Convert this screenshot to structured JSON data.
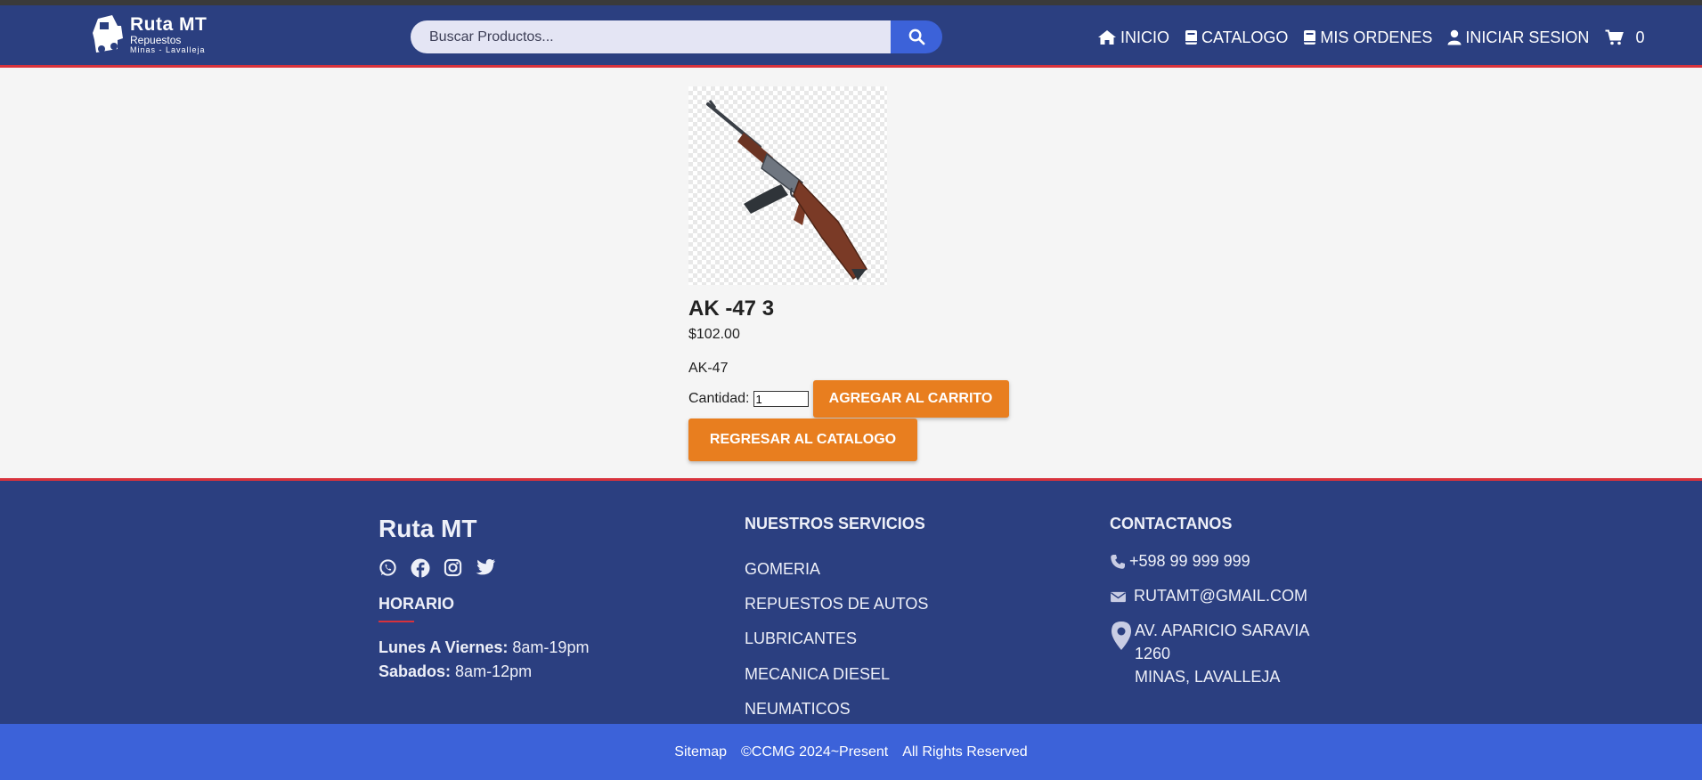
{
  "header": {
    "brand_name": "Ruta MT",
    "brand_sub": "Repuestos",
    "brand_location": "Minas - Lavalleja",
    "search_placeholder": "Buscar Productos...",
    "nav": [
      {
        "label": "INICIO",
        "icon": "home-icon"
      },
      {
        "label": "CATALOGO",
        "icon": "book-icon"
      },
      {
        "label": "MIS ORDENES",
        "icon": "book-icon"
      },
      {
        "label": "INICIAR SESION",
        "icon": "user-icon"
      }
    ],
    "cart_count": "0"
  },
  "product": {
    "title": "AK -47 3",
    "price": "$102.00",
    "description": "AK-47",
    "quantity_label": "Cantidad:",
    "quantity_value": "1",
    "add_to_cart_label": "AGREGAR AL CARRITO",
    "back_label": "REGRESAR AL CATALOGO"
  },
  "footer": {
    "brand": "Ruta MT",
    "social": [
      "whatsapp-icon",
      "facebook-icon",
      "instagram-icon",
      "twitter-icon"
    ],
    "hours_title": "HORARIO",
    "hours": [
      {
        "day": "Lunes A Viernes:",
        "time": "8am-19pm"
      },
      {
        "day": "Sabados:",
        "time": "8am-12pm"
      }
    ],
    "services_title": "NUESTROS SERVICIOS",
    "services": [
      "GOMERIA",
      "REPUESTOS DE AUTOS",
      "LUBRICANTES",
      "MECANICA DIESEL",
      "NEUMATICOS"
    ],
    "contact_title": "CONTACTANOS",
    "phone": "+598 99 999 999",
    "email": "RUTAMT@GMAIL.COM",
    "address_line1": "AV. APARICIO SARAVIA",
    "address_line2": "1260",
    "address_line3": "MINAS, LAVALLEJA"
  },
  "bottom": {
    "sitemap": "Sitemap",
    "copyright": "©CCMG 2024~Present",
    "rights": "All Rights Reserved"
  },
  "colors": {
    "header_bg": "#2b3f80",
    "accent_red": "#d8323c",
    "button_orange": "#e87e1f",
    "bottom_bar": "#3c62d9"
  }
}
